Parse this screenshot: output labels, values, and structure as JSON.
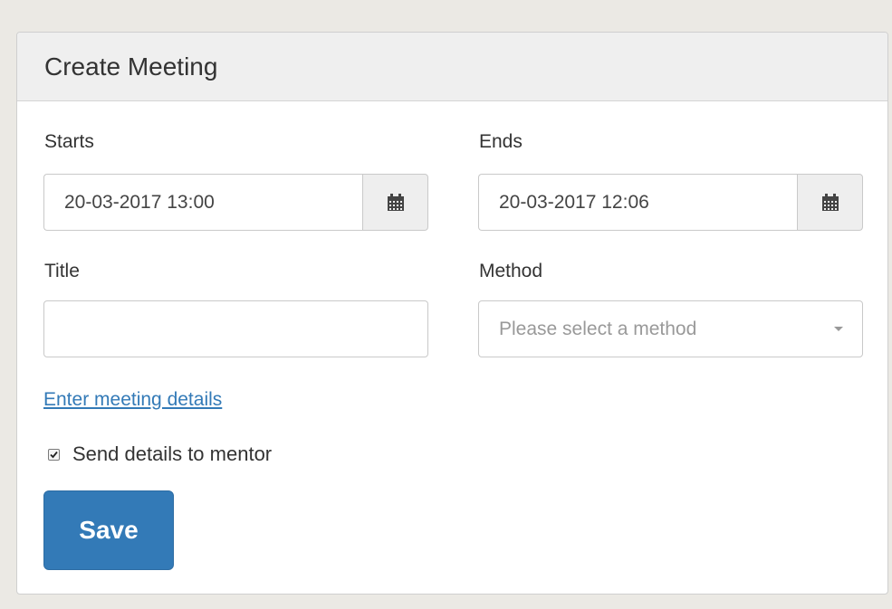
{
  "panel": {
    "title": "Create Meeting"
  },
  "form": {
    "starts": {
      "label": "Starts",
      "value": "20-03-2017 13:00"
    },
    "ends": {
      "label": "Ends",
      "value": "20-03-2017 12:06"
    },
    "title_field": {
      "label": "Title",
      "value": ""
    },
    "method": {
      "label": "Method",
      "placeholder": "Please select a method"
    },
    "details_link": "Enter meeting details",
    "send_details": {
      "label": "Send details to mentor",
      "checked": true
    },
    "save_label": "Save"
  },
  "icons": {
    "datepicker": "calendar-icon",
    "select_toggle": "caret-down-icon",
    "check": "check-icon"
  },
  "colors": {
    "primary": "#337ab7",
    "link": "#337ab7",
    "page_background": "#ebe9e4"
  }
}
